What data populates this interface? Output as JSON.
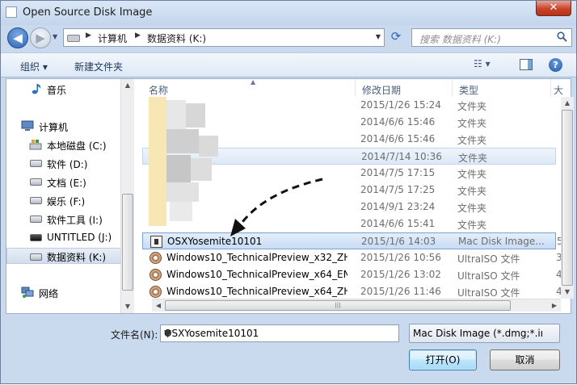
{
  "window": {
    "title": "Open Source Disk Image",
    "close_label": "✕"
  },
  "nav": {
    "back_label": "◀",
    "forward_label": "▶",
    "address": {
      "segments": [
        "计算机",
        "数据资料 (K:)"
      ]
    },
    "search_placeholder": "搜索 数据资料 (K:)"
  },
  "toolbar": {
    "organize_label": "组织 ▾",
    "new_folder_label": "新建文件夹",
    "view_label": "☷ ▾",
    "help_label": "?"
  },
  "sidebar": {
    "items": [
      {
        "label": "音乐",
        "icon": "music-icon"
      },
      {
        "label": "计算机",
        "icon": "computer-icon"
      },
      {
        "label": "本地磁盘 (C:)",
        "icon": "system-drive-icon"
      },
      {
        "label": "软件 (D:)",
        "icon": "drive-icon"
      },
      {
        "label": "文档 (E:)",
        "icon": "drive-icon"
      },
      {
        "label": "娱乐 (F:)",
        "icon": "drive-icon"
      },
      {
        "label": "软件工具 (I:)",
        "icon": "drive-icon"
      },
      {
        "label": "UNTITLED (J:)",
        "icon": "removable-drive-icon"
      },
      {
        "label": "数据资料 (K:)",
        "icon": "drive-icon",
        "selected": true
      },
      {
        "label": "网络",
        "icon": "network-icon"
      }
    ]
  },
  "columns": {
    "name": "名称",
    "date": "修改日期",
    "type": "类型",
    "size": "大"
  },
  "folder_rows": [
    {
      "date": "2015/1/26 15:24",
      "type": "文件夹"
    },
    {
      "date": "2014/6/6 15:46",
      "type": "文件夹"
    },
    {
      "date": "2014/6/6 15:46",
      "type": "文件夹"
    },
    {
      "date": "2014/7/14 10:36",
      "type": "文件夹",
      "highlighted": true
    },
    {
      "date": "2014/7/5 17:15",
      "type": "文件夹"
    },
    {
      "date": "2014/7/5 17:25",
      "type": "文件夹"
    },
    {
      "date": "2014/9/1 23:24",
      "type": "文件夹"
    },
    {
      "date": "2014/6/6 15:41",
      "type": "文件夹"
    }
  ],
  "file_rows": [
    {
      "name": "OSXYosemite10101",
      "date": "2015/1/6 14:03",
      "type": "Mac Disk Image...",
      "size": "5",
      "icon": "dmg-icon",
      "selected": true
    },
    {
      "name": "Windows10_TechnicalPreview_x32_ZH...",
      "date": "2015/1/26 10:56",
      "type": "UltraISO 文件",
      "size": "3",
      "icon": "iso-icon"
    },
    {
      "name": "Windows10_TechnicalPreview_x64_EN...",
      "date": "2015/1/26 13:02",
      "type": "UltraISO 文件",
      "size": "4",
      "icon": "iso-icon"
    },
    {
      "name": "Windows10_TechnicalPreview_x64_ZH...",
      "date": "2015/1/26 11:46",
      "type": "UltraISO 文件",
      "size": "4",
      "icon": "iso-icon"
    }
  ],
  "bottom": {
    "filename_label": "文件名(N):",
    "filename_value": "OSXYosemite10101",
    "filetype_value": "Mac Disk Image (*.dmg;*.im",
    "open_label": "打开(O)",
    "cancel_label": "取消"
  },
  "colors": {
    "accent": "#3569b9",
    "selection": "#c8dcf5",
    "annotation_arrow": "#111111"
  }
}
